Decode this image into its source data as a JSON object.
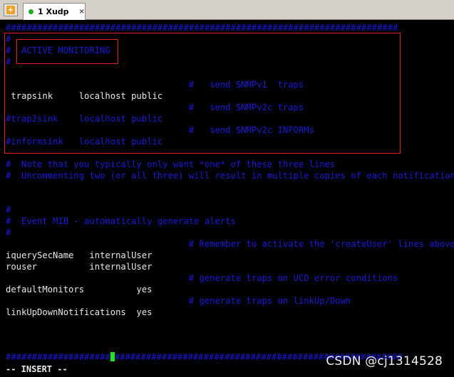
{
  "tabbar": {
    "new_tab_symbol": "+",
    "tab_label": "1 Xudp",
    "tab_close": "×"
  },
  "colors": {
    "comment": "#1a1ad8",
    "text": "#e8e8e8",
    "annotation": "#e02020",
    "cursor": "#1ee81e"
  },
  "terminal": {
    "l01": "###########################################################################",
    "l02": "#",
    "l03": "#  ACTIVE MONITORING",
    "l04": "#",
    "l05": "                                   #   send SNMPv1  traps",
    "l06": " trapsink     localhost public",
    "l07": "                                   #   send SNMPv2c traps",
    "l08": "#trap2sink    localhost public",
    "l09": "                                   #   send SNMPv2c INFORMs",
    "l10": "#informsink   localhost public",
    "l11": "#  Note that you typically only want *one* of these three lines",
    "l12": "#  Uncommenting two (or all three) will result in multiple copies of each notification.",
    "l13": "#",
    "l14": "#  Event MIB - automatically generate alerts",
    "l15": "#",
    "l16": "                                   # Remember to activate the 'createUser' lines above",
    "l17": "iquerySecName   internalUser",
    "l18": "rouser          internalUser",
    "l19": "                                   # generate traps on UCD error conditions",
    "l20": "defaultMonitors          yes",
    "l21": "                                   # generate traps on linkUp/Down",
    "l22": "linkUpDownNotifications  yes",
    "l23a": "####################",
    "l23b": "#######################################################"
  },
  "status_line": "-- INSERT --",
  "watermark": "CSDN @cj1314528"
}
